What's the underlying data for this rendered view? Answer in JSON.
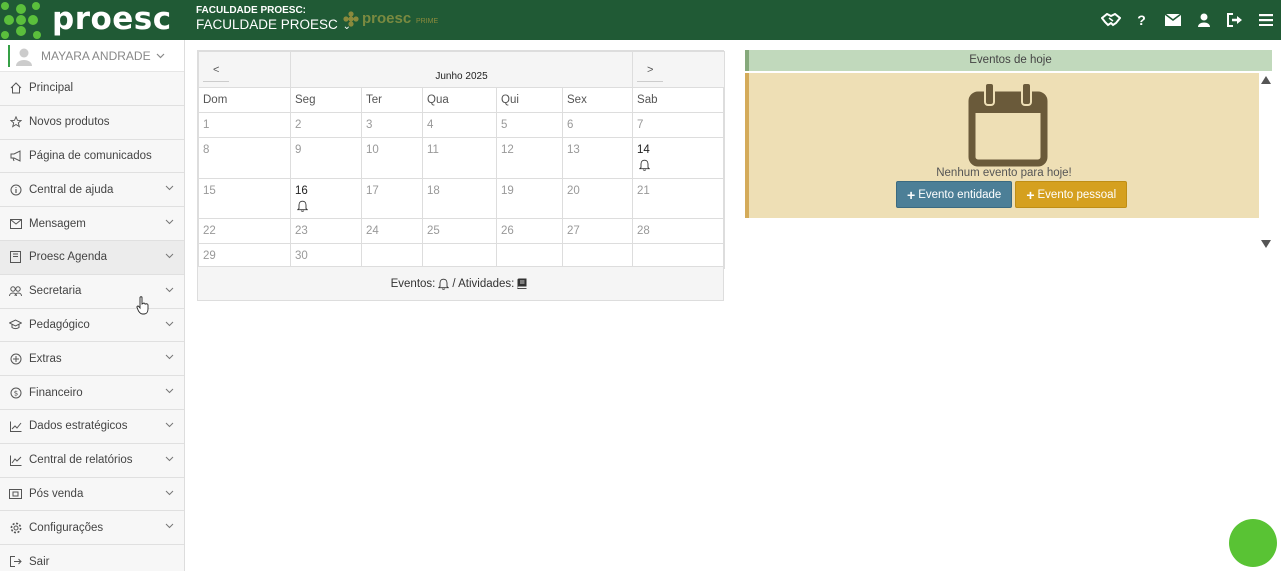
{
  "header": {
    "brand": "proesc",
    "institution_label": "FACULDADE PROESC:",
    "institution_name": "FACULDADE PROESC",
    "prime_logo": "proesc",
    "prime_sub": "PRIME",
    "icons": [
      "handshake-icon",
      "help-icon",
      "mail-icon",
      "user-icon",
      "logout-icon",
      "menu-icon"
    ],
    "colors": {
      "bar": "#205a35",
      "logo_green": "#5bbf3c"
    }
  },
  "sidebar": {
    "user_name": "MAYARA ANDRADE",
    "items": [
      {
        "label": "Principal",
        "icon": "home-icon",
        "has_submenu": false
      },
      {
        "label": "Novos produtos",
        "icon": "star-icon",
        "has_submenu": false
      },
      {
        "label": "Página de comunicados",
        "icon": "megaphone-icon",
        "has_submenu": false
      },
      {
        "label": "Central de ajuda",
        "icon": "info-icon",
        "has_submenu": true
      },
      {
        "label": "Mensagem",
        "icon": "envelope-icon",
        "has_submenu": true
      },
      {
        "label": "Proesc Agenda",
        "icon": "book-icon",
        "has_submenu": true
      },
      {
        "label": "Secretaria",
        "icon": "users-icon",
        "has_submenu": true
      },
      {
        "label": "Pedagógico",
        "icon": "graduation-icon",
        "has_submenu": true
      },
      {
        "label": "Extras",
        "icon": "plus-circle-icon",
        "has_submenu": true
      },
      {
        "label": "Financeiro",
        "icon": "dollar-icon",
        "has_submenu": true
      },
      {
        "label": "Dados estratégicos",
        "icon": "chart-icon",
        "has_submenu": true
      },
      {
        "label": "Central de relatórios",
        "icon": "report-icon",
        "has_submenu": true
      },
      {
        "label": "Pós venda",
        "icon": "ticket-icon",
        "has_submenu": true
      },
      {
        "label": "Configurações",
        "icon": "gear-icon",
        "has_submenu": true
      },
      {
        "label": "Sair",
        "icon": "exit-icon",
        "has_submenu": false
      }
    ]
  },
  "calendar": {
    "prev": "<",
    "next": ">",
    "month": "Junho 2025",
    "weekdays": [
      "Dom",
      "Seg",
      "Ter",
      "Qua",
      "Qui",
      "Sex",
      "Sab"
    ],
    "weeks": [
      [
        "1",
        "2",
        "3",
        "4",
        "5",
        "6",
        "7"
      ],
      [
        "8",
        "9",
        "10",
        "11",
        "12",
        "13",
        "14"
      ],
      [
        "15",
        "16",
        "17",
        "18",
        "19",
        "20",
        "21"
      ],
      [
        "22",
        "23",
        "24",
        "25",
        "26",
        "27",
        "28"
      ],
      [
        "29",
        "30",
        "",
        "",
        "",
        "",
        ""
      ]
    ],
    "event_days": [
      "14",
      "16"
    ],
    "legend_events": "Eventos:",
    "legend_activities": "/ Atividades:"
  },
  "events_today": {
    "title": "Eventos de hoje",
    "empty_text": "Nenhum evento para hoje!",
    "btn_entity": "Evento entidade",
    "btn_personal": "Evento pessoal"
  }
}
